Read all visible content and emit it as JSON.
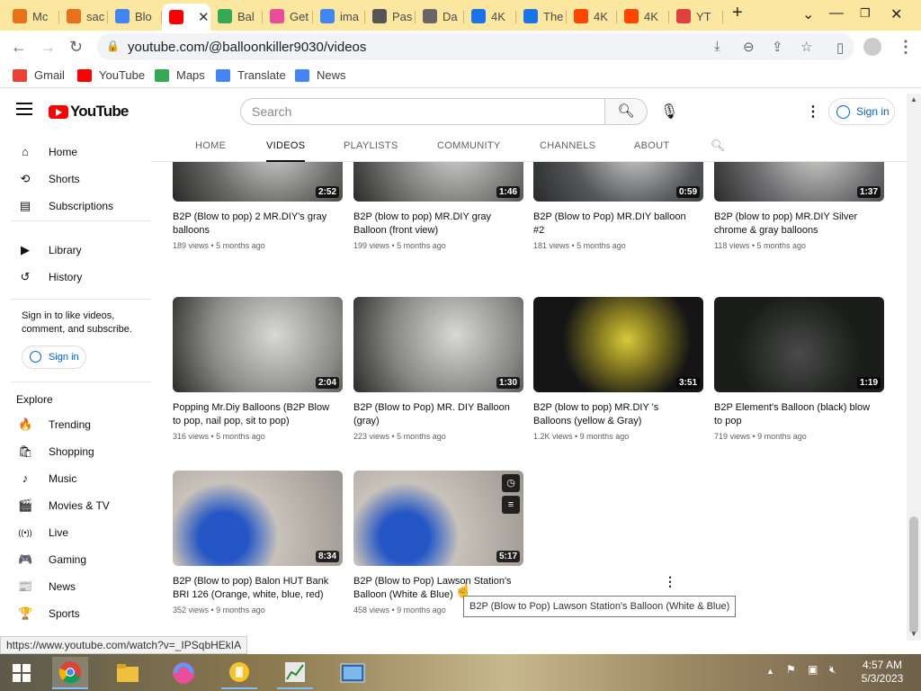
{
  "browser": {
    "tabs": [
      {
        "label": "Mc",
        "color": "#e8711a"
      },
      {
        "label": "sac",
        "color": "#e8711a"
      },
      {
        "label": "Blo",
        "color": "#4285f4"
      },
      {
        "label": "",
        "color": "#ff0000",
        "active": true
      },
      {
        "label": "Bal",
        "color": "#34a853"
      },
      {
        "label": "Get",
        "color": "#e94e9a"
      },
      {
        "label": "ima",
        "color": "#4285f4"
      },
      {
        "label": "Pas",
        "color": "#555555"
      },
      {
        "label": "Da",
        "color": "#666666"
      },
      {
        "label": "4K",
        "color": "#1a73e8"
      },
      {
        "label": "The",
        "color": "#1a73e8"
      },
      {
        "label": "4K",
        "color": "#ff4500"
      },
      {
        "label": "4K",
        "color": "#ff4500"
      },
      {
        "label": "YT",
        "color": "#e04040"
      }
    ],
    "new_tab": "+",
    "url": "youtube.com/@balloonkiller9030/videos",
    "bookmarks": [
      {
        "label": "Gmail",
        "color": "#ea4335"
      },
      {
        "label": "YouTube",
        "color": "#ff0000"
      },
      {
        "label": "Maps",
        "color": "#34a853"
      },
      {
        "label": "Translate",
        "color": "#4285f4"
      },
      {
        "label": "News",
        "color": "#4285f4"
      }
    ],
    "status_link": "https://www.youtube.com/watch?v=_IPSqbHEkIA"
  },
  "youtube": {
    "logo_text": "YouTube",
    "search_placeholder": "Search",
    "signin": "Sign in"
  },
  "sidebar": {
    "main": [
      {
        "label": "Home",
        "icon": "⌂"
      },
      {
        "label": "Shorts",
        "icon": "⟲"
      },
      {
        "label": "Subscriptions",
        "icon": "▤"
      }
    ],
    "library": [
      {
        "label": "Library",
        "icon": "▶"
      },
      {
        "label": "History",
        "icon": "↺"
      }
    ],
    "signin_note": "Sign in to like videos, comment, and subscribe.",
    "signin": "Sign in",
    "explore_heading": "Explore",
    "explore": [
      {
        "label": "Trending",
        "icon": "🔥"
      },
      {
        "label": "Shopping",
        "icon": "🛍"
      },
      {
        "label": "Music",
        "icon": "♪"
      },
      {
        "label": "Movies & TV",
        "icon": "🎬"
      },
      {
        "label": "Live",
        "icon": "((•))"
      },
      {
        "label": "Gaming",
        "icon": "🎮"
      },
      {
        "label": "News",
        "icon": "📰"
      },
      {
        "label": "Sports",
        "icon": "🏆"
      }
    ]
  },
  "channel_tabs": [
    "HOME",
    "VIDEOS",
    "PLAYLISTS",
    "COMMUNITY",
    "CHANNELS",
    "ABOUT"
  ],
  "videos": [
    {
      "title": "B2P (Blow to pop) 2 MR.DIY's gray balloons",
      "meta": "189 views • 5 months ago",
      "duration": "2:52",
      "bg": "#6a6a68"
    },
    {
      "title": "B2P (blow to pop) MR.DIY gray Balloon (front view)",
      "meta": "199 views • 5 months ago",
      "duration": "1:46",
      "bg": "#7a7a78"
    },
    {
      "title": "B2P (Blow to Pop) MR.DIY balloon #2",
      "meta": "181 views • 5 months ago",
      "duration": "0:59",
      "bg": "#55575a"
    },
    {
      "title": "B2P (blow to pop) MR.DIY Silver chrome & gray balloons",
      "meta": "118 views • 5 months ago",
      "duration": "1:37",
      "bg": "#6e6e70"
    },
    {
      "title": "Popping Mr.Diy Balloons (B2P Blow to pop, nail pop, sit to pop)",
      "meta": "316 views • 5 months ago",
      "duration": "2:04",
      "bg": "#8a8a88"
    },
    {
      "title": "B2P (Blow to Pop) MR. DIY Balloon (gray)",
      "meta": "223 views • 5 months ago",
      "duration": "1:30",
      "bg": "#858583"
    },
    {
      "title": "B2P (blow to pop) MR.DIY 's Balloons (yellow & Gray)",
      "meta": "1.2K views • 9 months ago",
      "duration": "3:51",
      "bg": "#1b1b1b"
    },
    {
      "title": "B2P Element's Balloon (black) blow to pop",
      "meta": "719 views • 9 months ago",
      "duration": "1:19",
      "bg": "#1e2320"
    },
    {
      "title": "B2P (Blow to pop) Balon HUT Bank BRI 126 (Orange, white, blue, red)",
      "meta": "352 views • 9 months ago",
      "duration": "8:34",
      "bg": "#b5b0aa"
    },
    {
      "title": "B2P (Blow to Pop) Lawson Station's Balloon (White & Blue)",
      "meta": "458 views • 9 months ago",
      "duration": "5:17",
      "bg": "#aaa59f"
    }
  ],
  "tooltip": "B2P (Blow to Pop) Lawson Station's Balloon (White & Blue)",
  "taskbar": {
    "time": "4:57 AM",
    "date": "5/3/2023"
  }
}
